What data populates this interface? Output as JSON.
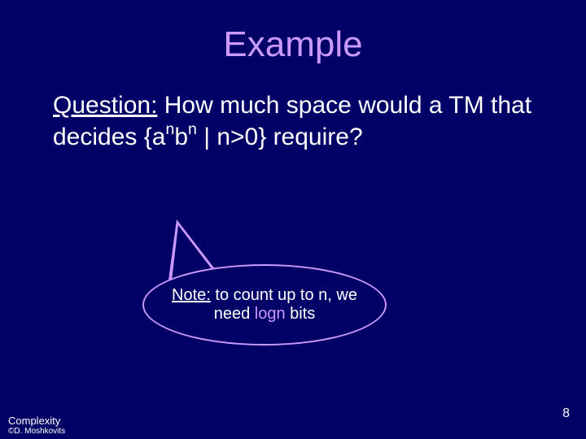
{
  "title": "Example",
  "question": {
    "label": "Question:",
    "part1": " How much space would a TM that decides {a",
    "sup1": "n",
    "part2": "b",
    "sup2": "n",
    "part3": " | n>0} require?"
  },
  "callout": {
    "noteLabel": "Note:",
    "part1": " to count up to n, we need ",
    "logn": "logn",
    "part2": " bits"
  },
  "footer": {
    "line1": "Complexity",
    "line2": "©D. Moshkovits",
    "pageNumber": "8"
  }
}
